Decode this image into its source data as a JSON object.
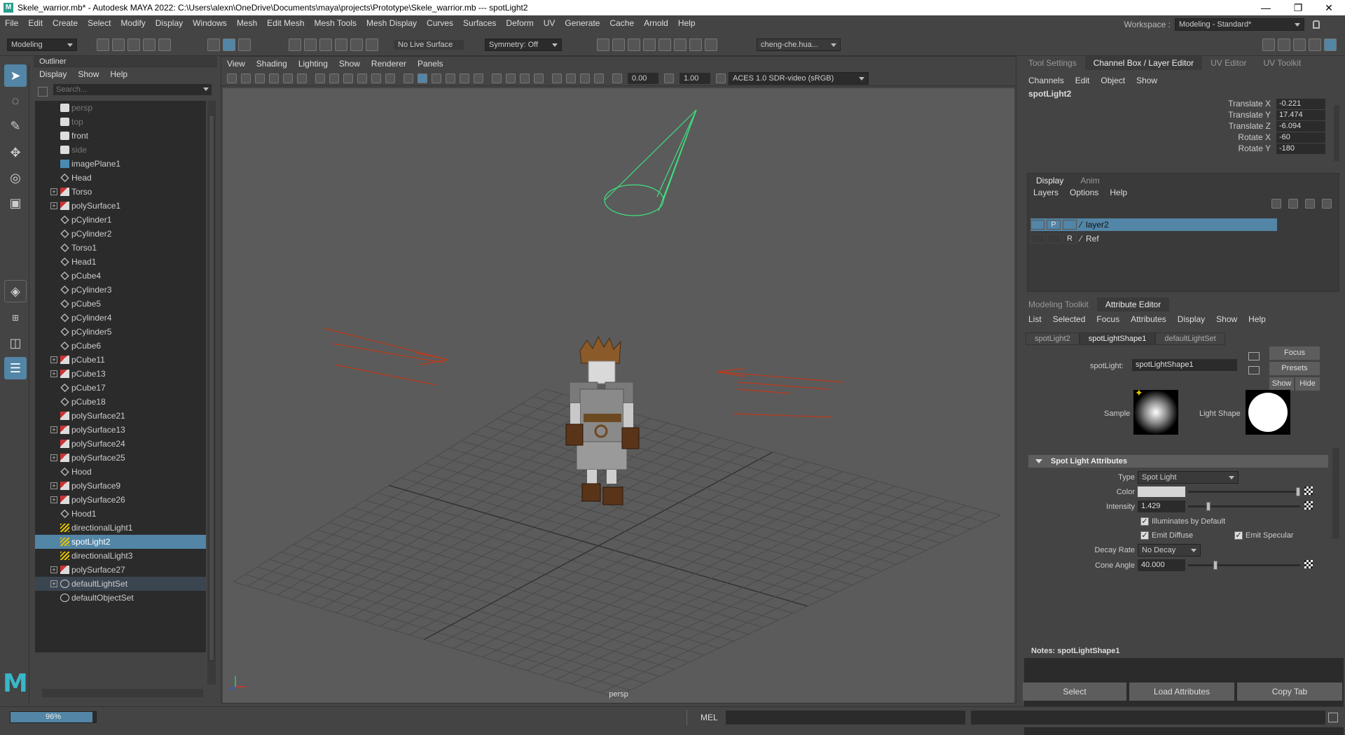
{
  "window": {
    "title": "Skele_warrior.mb* - Autodesk MAYA 2022: C:\\Users\\alexn\\OneDrive\\Documents\\maya\\projects\\Prototype\\Skele_warrior.mb  ---  spotLight2",
    "minimize": "—",
    "maximize": "❐",
    "close": "✕"
  },
  "menu": [
    "File",
    "Edit",
    "Create",
    "Select",
    "Modify",
    "Display",
    "Windows",
    "Mesh",
    "Edit Mesh",
    "Mesh Tools",
    "Mesh Display",
    "Curves",
    "Surfaces",
    "Deform",
    "UV",
    "Generate",
    "Cache",
    "Arnold",
    "Help"
  ],
  "workspace": {
    "label": "Workspace :",
    "value": "Modeling - Standard*"
  },
  "statusline": {
    "mode": "Modeling",
    "live_surface": "No Live Surface",
    "symmetry": "Symmetry: Off",
    "user": "cheng-che.hua..."
  },
  "outliner": {
    "title": "Outliner",
    "menu": [
      "Display",
      "Show",
      "Help"
    ],
    "search_placeholder": "Search...",
    "items": [
      {
        "label": "persp",
        "icon": "camera-icon",
        "dim": true,
        "exp": false
      },
      {
        "label": "top",
        "icon": "camera-icon",
        "dim": true,
        "exp": false
      },
      {
        "label": "front",
        "icon": "camera-icon",
        "dim": false,
        "exp": false
      },
      {
        "label": "side",
        "icon": "camera-icon",
        "dim": true,
        "exp": false
      },
      {
        "label": "imagePlane1",
        "icon": "image-plane-icon",
        "dim": false,
        "exp": false
      },
      {
        "label": "Head",
        "icon": "mesh-icon",
        "dim": false,
        "exp": false
      },
      {
        "label": "Torso",
        "icon": "poly-icon",
        "dim": false,
        "exp": true
      },
      {
        "label": "polySurface1",
        "icon": "poly-icon",
        "dim": false,
        "exp": true
      },
      {
        "label": "pCylinder1",
        "icon": "mesh-icon",
        "dim": false,
        "exp": false
      },
      {
        "label": "pCylinder2",
        "icon": "mesh-icon",
        "dim": false,
        "exp": false
      },
      {
        "label": "Torso1",
        "icon": "mesh-icon",
        "dim": false,
        "exp": false
      },
      {
        "label": "Head1",
        "icon": "mesh-icon",
        "dim": false,
        "exp": false
      },
      {
        "label": "pCube4",
        "icon": "mesh-icon",
        "dim": false,
        "exp": false
      },
      {
        "label": "pCylinder3",
        "icon": "mesh-icon",
        "dim": false,
        "exp": false
      },
      {
        "label": "pCube5",
        "icon": "mesh-icon",
        "dim": false,
        "exp": false
      },
      {
        "label": "pCylinder4",
        "icon": "mesh-icon",
        "dim": false,
        "exp": false
      },
      {
        "label": "pCylinder5",
        "icon": "mesh-icon",
        "dim": false,
        "exp": false
      },
      {
        "label": "pCube6",
        "icon": "mesh-icon",
        "dim": false,
        "exp": false
      },
      {
        "label": "pCube11",
        "icon": "poly-icon",
        "dim": false,
        "exp": true
      },
      {
        "label": "pCube13",
        "icon": "poly-icon",
        "dim": false,
        "exp": true
      },
      {
        "label": "pCube17",
        "icon": "mesh-icon",
        "dim": false,
        "exp": false
      },
      {
        "label": "pCube18",
        "icon": "mesh-icon",
        "dim": false,
        "exp": false
      },
      {
        "label": "polySurface21",
        "icon": "poly-icon",
        "dim": false,
        "exp": false
      },
      {
        "label": "polySurface13",
        "icon": "poly-icon",
        "dim": false,
        "exp": true
      },
      {
        "label": "polySurface24",
        "icon": "poly-icon",
        "dim": false,
        "exp": false
      },
      {
        "label": "polySurface25",
        "icon": "poly-icon",
        "dim": false,
        "exp": true
      },
      {
        "label": "Hood",
        "icon": "mesh-icon",
        "dim": false,
        "exp": false
      },
      {
        "label": "polySurface9",
        "icon": "poly-icon",
        "dim": false,
        "exp": true
      },
      {
        "label": "polySurface26",
        "icon": "poly-icon",
        "dim": false,
        "exp": true
      },
      {
        "label": "Hood1",
        "icon": "mesh-icon",
        "dim": false,
        "exp": false
      },
      {
        "label": "directionalLight1",
        "icon": "light-icon",
        "dim": false,
        "exp": false
      },
      {
        "label": "spotLight2",
        "icon": "light-icon",
        "dim": false,
        "exp": false,
        "selected": true
      },
      {
        "label": "directionalLight3",
        "icon": "light-icon",
        "dim": false,
        "exp": false
      },
      {
        "label": "polySurface27",
        "icon": "poly-icon",
        "dim": false,
        "exp": true
      },
      {
        "label": "defaultLightSet",
        "icon": "set-icon",
        "dim": false,
        "exp": true,
        "hover": true
      },
      {
        "label": "defaultObjectSet",
        "icon": "set-icon",
        "dim": false,
        "exp": false
      }
    ]
  },
  "viewport": {
    "menu": [
      "View",
      "Shading",
      "Lighting",
      "Show",
      "Renderer",
      "Panels"
    ],
    "field1": "0.00",
    "field2": "1.00",
    "colorspace": "ACES 1.0 SDR-video (sRGB)",
    "camera": "persp"
  },
  "right": {
    "tabs": [
      "Tool Settings",
      "Channel Box / Layer Editor",
      "UV Editor",
      "UV Toolkit"
    ],
    "channel_menu": [
      "Channels",
      "Edit",
      "Object",
      "Show"
    ],
    "object": "spotLight2",
    "channels": [
      {
        "label": "Translate X",
        "value": "-0.221"
      },
      {
        "label": "Translate Y",
        "value": "17.474"
      },
      {
        "label": "Translate Z",
        "value": "-6.094"
      },
      {
        "label": "Rotate X",
        "value": "-60"
      },
      {
        "label": "Rotate Y",
        "value": "-180"
      }
    ],
    "layer_tabs": [
      "Display",
      "Anim"
    ],
    "layer_menu": [
      "Layers",
      "Options",
      "Help"
    ],
    "layers": [
      {
        "p": "P",
        "r": "",
        "name": "layer2"
      },
      {
        "p": "",
        "r": "R",
        "name": "Ref"
      }
    ],
    "ae_tabs": [
      "Modeling Toolkit",
      "Attribute Editor"
    ],
    "ae_menu": [
      "List",
      "Selected",
      "Focus",
      "Attributes",
      "Display",
      "Show",
      "Help"
    ],
    "node_tabs": [
      "spotLight2",
      "spotLightShape1",
      "defaultLightSet"
    ],
    "node_label": "spotLight:",
    "node_value": "spotLightShape1",
    "focus": "Focus",
    "presets": "Presets",
    "show": "Show",
    "hide": "Hide",
    "sample": "Sample",
    "light_shape": "Light Shape",
    "section": "Spot Light Attributes",
    "type_label": "Type",
    "type_value": "Spot Light",
    "color_label": "Color",
    "intensity_label": "Intensity",
    "intensity_value": "1.429",
    "illum": "Illuminates by Default",
    "emit_diffuse": "Emit Diffuse",
    "emit_specular": "Emit Specular",
    "decay_label": "Decay Rate",
    "decay_value": "No Decay",
    "cone_label": "Cone Angle",
    "cone_value": "40.000",
    "notes": "Notes:  spotLightShape1",
    "btn_select": "Select",
    "btn_load": "Load Attributes",
    "btn_copy": "Copy Tab"
  },
  "bottom": {
    "progress_label": "96%",
    "progress_value": 0.96,
    "mel": "MEL"
  }
}
